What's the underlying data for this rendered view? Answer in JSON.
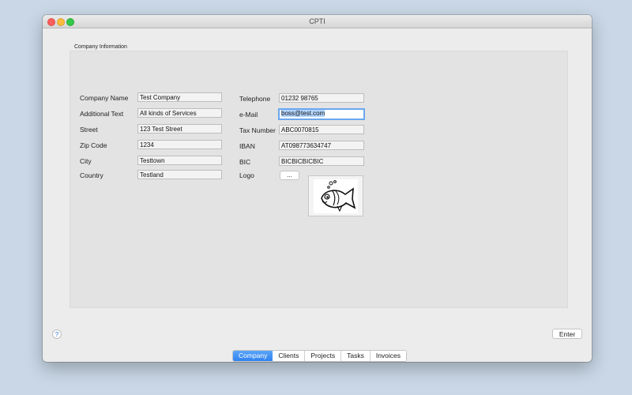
{
  "window": {
    "title": "CPTI"
  },
  "group": {
    "label": "Company Information"
  },
  "left_fields": [
    {
      "label": "Company Name",
      "value": "Test Company"
    },
    {
      "label": "Additional Text",
      "value": "All kinds of Services"
    },
    {
      "label": "Street",
      "value": "123 Test Street"
    },
    {
      "label": "Zip Code",
      "value": "1234"
    },
    {
      "label": "City",
      "value": "Testtown"
    },
    {
      "label": "Country",
      "value": "Testland"
    }
  ],
  "right_fields": [
    {
      "label": "Telephone",
      "value": "01232 98765"
    },
    {
      "label": "e-Mail",
      "value": "boss@test.com"
    },
    {
      "label": "Tax Number",
      "value": "ABC0070815"
    },
    {
      "label": "IBAN",
      "value": "AT098773634747"
    },
    {
      "label": "BIC",
      "value": "BICBICBICBIC"
    }
  ],
  "logo": {
    "label": "Logo",
    "button": "...",
    "image": "fish-icon"
  },
  "help": "?",
  "enter_button": "Enter",
  "tabs": [
    {
      "label": "Company",
      "active": true
    },
    {
      "label": "Clients"
    },
    {
      "label": "Projects"
    },
    {
      "label": "Tasks"
    },
    {
      "label": "Invoices"
    }
  ],
  "colors": {
    "accent": "#2f82f0",
    "focus_ring": "#6aa7ef"
  }
}
